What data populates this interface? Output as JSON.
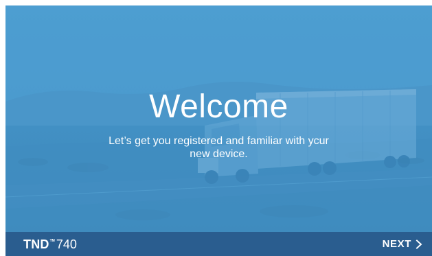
{
  "welcome": {
    "title": "Welcome",
    "subtitle": "Let’s get you registered and familiar with ycur new device.",
    "background_image": "semi-truck-on-highway-photo",
    "overlay_color": "#4a9bcf"
  },
  "nav_bar": {
    "background_color": "#2a5d8f",
    "brand": {
      "name": "TND",
      "trademark": "TM",
      "model": "740"
    },
    "next_button": {
      "label": "NEXT",
      "icon": "chevron-right-icon"
    }
  }
}
